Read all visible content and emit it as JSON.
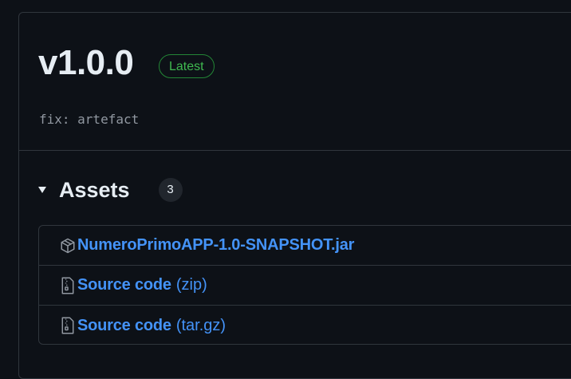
{
  "release": {
    "version": "v1.0.0",
    "badge": "Latest",
    "commit_message": "fix: artefact"
  },
  "assets": {
    "title": "Assets",
    "count": "3",
    "items": [
      {
        "name": "NumeroPrimoAPP-1.0-SNAPSHOT.jar",
        "ext": "",
        "icon": "package-icon"
      },
      {
        "name": "Source code",
        "ext": "(zip)",
        "icon": "file-zip-icon"
      },
      {
        "name": "Source code",
        "ext": "(tar.gz)",
        "icon": "file-zip-icon"
      }
    ]
  },
  "colors": {
    "background": "#0d1117",
    "border": "#30363d",
    "link": "#4493f8",
    "badge_green": "#3fb950"
  }
}
